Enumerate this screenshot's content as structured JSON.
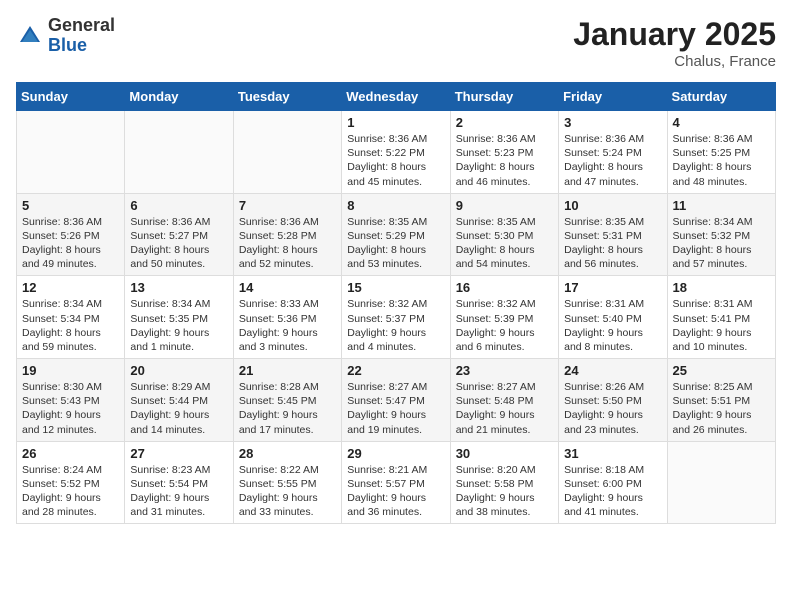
{
  "header": {
    "logo_general": "General",
    "logo_blue": "Blue",
    "title": "January 2025",
    "location": "Chalus, France"
  },
  "days_of_week": [
    "Sunday",
    "Monday",
    "Tuesday",
    "Wednesday",
    "Thursday",
    "Friday",
    "Saturday"
  ],
  "weeks": [
    [
      {
        "day": "",
        "text": ""
      },
      {
        "day": "",
        "text": ""
      },
      {
        "day": "",
        "text": ""
      },
      {
        "day": "1",
        "text": "Sunrise: 8:36 AM\nSunset: 5:22 PM\nDaylight: 8 hours and 45 minutes."
      },
      {
        "day": "2",
        "text": "Sunrise: 8:36 AM\nSunset: 5:23 PM\nDaylight: 8 hours and 46 minutes."
      },
      {
        "day": "3",
        "text": "Sunrise: 8:36 AM\nSunset: 5:24 PM\nDaylight: 8 hours and 47 minutes."
      },
      {
        "day": "4",
        "text": "Sunrise: 8:36 AM\nSunset: 5:25 PM\nDaylight: 8 hours and 48 minutes."
      }
    ],
    [
      {
        "day": "5",
        "text": "Sunrise: 8:36 AM\nSunset: 5:26 PM\nDaylight: 8 hours and 49 minutes."
      },
      {
        "day": "6",
        "text": "Sunrise: 8:36 AM\nSunset: 5:27 PM\nDaylight: 8 hours and 50 minutes."
      },
      {
        "day": "7",
        "text": "Sunrise: 8:36 AM\nSunset: 5:28 PM\nDaylight: 8 hours and 52 minutes."
      },
      {
        "day": "8",
        "text": "Sunrise: 8:35 AM\nSunset: 5:29 PM\nDaylight: 8 hours and 53 minutes."
      },
      {
        "day": "9",
        "text": "Sunrise: 8:35 AM\nSunset: 5:30 PM\nDaylight: 8 hours and 54 minutes."
      },
      {
        "day": "10",
        "text": "Sunrise: 8:35 AM\nSunset: 5:31 PM\nDaylight: 8 hours and 56 minutes."
      },
      {
        "day": "11",
        "text": "Sunrise: 8:34 AM\nSunset: 5:32 PM\nDaylight: 8 hours and 57 minutes."
      }
    ],
    [
      {
        "day": "12",
        "text": "Sunrise: 8:34 AM\nSunset: 5:34 PM\nDaylight: 8 hours and 59 minutes."
      },
      {
        "day": "13",
        "text": "Sunrise: 8:34 AM\nSunset: 5:35 PM\nDaylight: 9 hours and 1 minute."
      },
      {
        "day": "14",
        "text": "Sunrise: 8:33 AM\nSunset: 5:36 PM\nDaylight: 9 hours and 3 minutes."
      },
      {
        "day": "15",
        "text": "Sunrise: 8:32 AM\nSunset: 5:37 PM\nDaylight: 9 hours and 4 minutes."
      },
      {
        "day": "16",
        "text": "Sunrise: 8:32 AM\nSunset: 5:39 PM\nDaylight: 9 hours and 6 minutes."
      },
      {
        "day": "17",
        "text": "Sunrise: 8:31 AM\nSunset: 5:40 PM\nDaylight: 9 hours and 8 minutes."
      },
      {
        "day": "18",
        "text": "Sunrise: 8:31 AM\nSunset: 5:41 PM\nDaylight: 9 hours and 10 minutes."
      }
    ],
    [
      {
        "day": "19",
        "text": "Sunrise: 8:30 AM\nSunset: 5:43 PM\nDaylight: 9 hours and 12 minutes."
      },
      {
        "day": "20",
        "text": "Sunrise: 8:29 AM\nSunset: 5:44 PM\nDaylight: 9 hours and 14 minutes."
      },
      {
        "day": "21",
        "text": "Sunrise: 8:28 AM\nSunset: 5:45 PM\nDaylight: 9 hours and 17 minutes."
      },
      {
        "day": "22",
        "text": "Sunrise: 8:27 AM\nSunset: 5:47 PM\nDaylight: 9 hours and 19 minutes."
      },
      {
        "day": "23",
        "text": "Sunrise: 8:27 AM\nSunset: 5:48 PM\nDaylight: 9 hours and 21 minutes."
      },
      {
        "day": "24",
        "text": "Sunrise: 8:26 AM\nSunset: 5:50 PM\nDaylight: 9 hours and 23 minutes."
      },
      {
        "day": "25",
        "text": "Sunrise: 8:25 AM\nSunset: 5:51 PM\nDaylight: 9 hours and 26 minutes."
      }
    ],
    [
      {
        "day": "26",
        "text": "Sunrise: 8:24 AM\nSunset: 5:52 PM\nDaylight: 9 hours and 28 minutes."
      },
      {
        "day": "27",
        "text": "Sunrise: 8:23 AM\nSunset: 5:54 PM\nDaylight: 9 hours and 31 minutes."
      },
      {
        "day": "28",
        "text": "Sunrise: 8:22 AM\nSunset: 5:55 PM\nDaylight: 9 hours and 33 minutes."
      },
      {
        "day": "29",
        "text": "Sunrise: 8:21 AM\nSunset: 5:57 PM\nDaylight: 9 hours and 36 minutes."
      },
      {
        "day": "30",
        "text": "Sunrise: 8:20 AM\nSunset: 5:58 PM\nDaylight: 9 hours and 38 minutes."
      },
      {
        "day": "31",
        "text": "Sunrise: 8:18 AM\nSunset: 6:00 PM\nDaylight: 9 hours and 41 minutes."
      },
      {
        "day": "",
        "text": ""
      }
    ]
  ]
}
